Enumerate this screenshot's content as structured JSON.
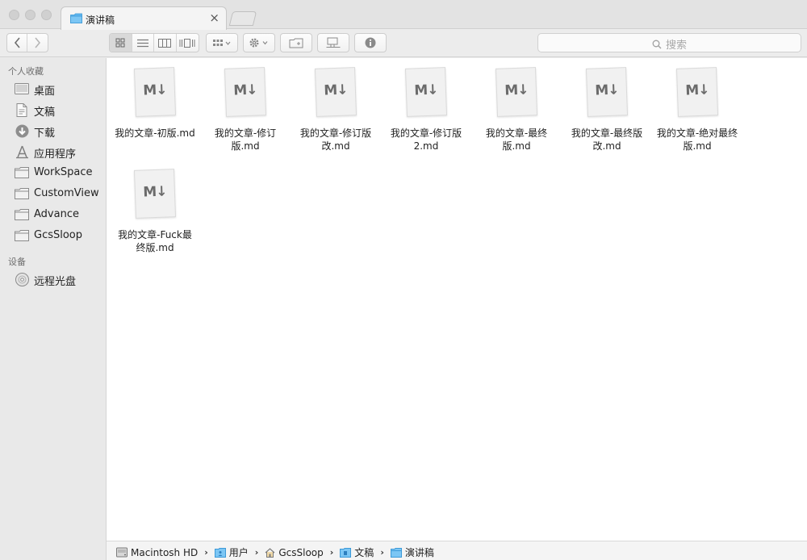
{
  "tab": {
    "title": "演讲稿",
    "close_glyph": "×"
  },
  "toolbar": {
    "search_placeholder": "搜索",
    "view_modes": [
      "icon-view",
      "list-view",
      "column-view",
      "coverflow-view"
    ],
    "active_view": "icon-view"
  },
  "sidebar": {
    "favorites_heading": "个人收藏",
    "favorites": [
      {
        "label": "桌面",
        "icon": "desktop-icon"
      },
      {
        "label": "文稿",
        "icon": "documents-icon"
      },
      {
        "label": "下载",
        "icon": "download-icon"
      },
      {
        "label": "应用程序",
        "icon": "applications-icon"
      },
      {
        "label": "WorkSpace",
        "icon": "folder-icon"
      },
      {
        "label": "CustomView",
        "icon": "folder-icon"
      },
      {
        "label": "Advance",
        "icon": "folder-icon"
      },
      {
        "label": "GcsSloop",
        "icon": "folder-icon"
      }
    ],
    "devices_heading": "设备",
    "devices": [
      {
        "label": "远程光盘",
        "icon": "optical-disc-icon"
      }
    ]
  },
  "files": {
    "mark": "M↓",
    "items": [
      {
        "line1": "我的文章-初版.md",
        "line2": ""
      },
      {
        "line1": "我的文章-修订",
        "line2": "版.md"
      },
      {
        "line1": "我的文章-修订版",
        "line2": "改.md"
      },
      {
        "line1": "我的文章-修订版",
        "line2": "2.md"
      },
      {
        "line1": "我的文章-最终",
        "line2": "版.md"
      },
      {
        "line1": "我的文章-最终版",
        "line2": "改.md"
      },
      {
        "line1": "我的文章-绝对最终",
        "line2": "版.md"
      },
      {
        "line1": "我的文章-Fuck最",
        "line2": "终版.md"
      }
    ]
  },
  "pathbar": {
    "separator": "›",
    "crumbs": [
      "Macintosh HD",
      "用户",
      "GcsSloop",
      "文稿",
      "演讲稿"
    ]
  },
  "colors": {
    "folder_blue": "#5fb6ef",
    "folder_gray": "#9d9d9d",
    "icon_gray": "#7a7a7a"
  }
}
